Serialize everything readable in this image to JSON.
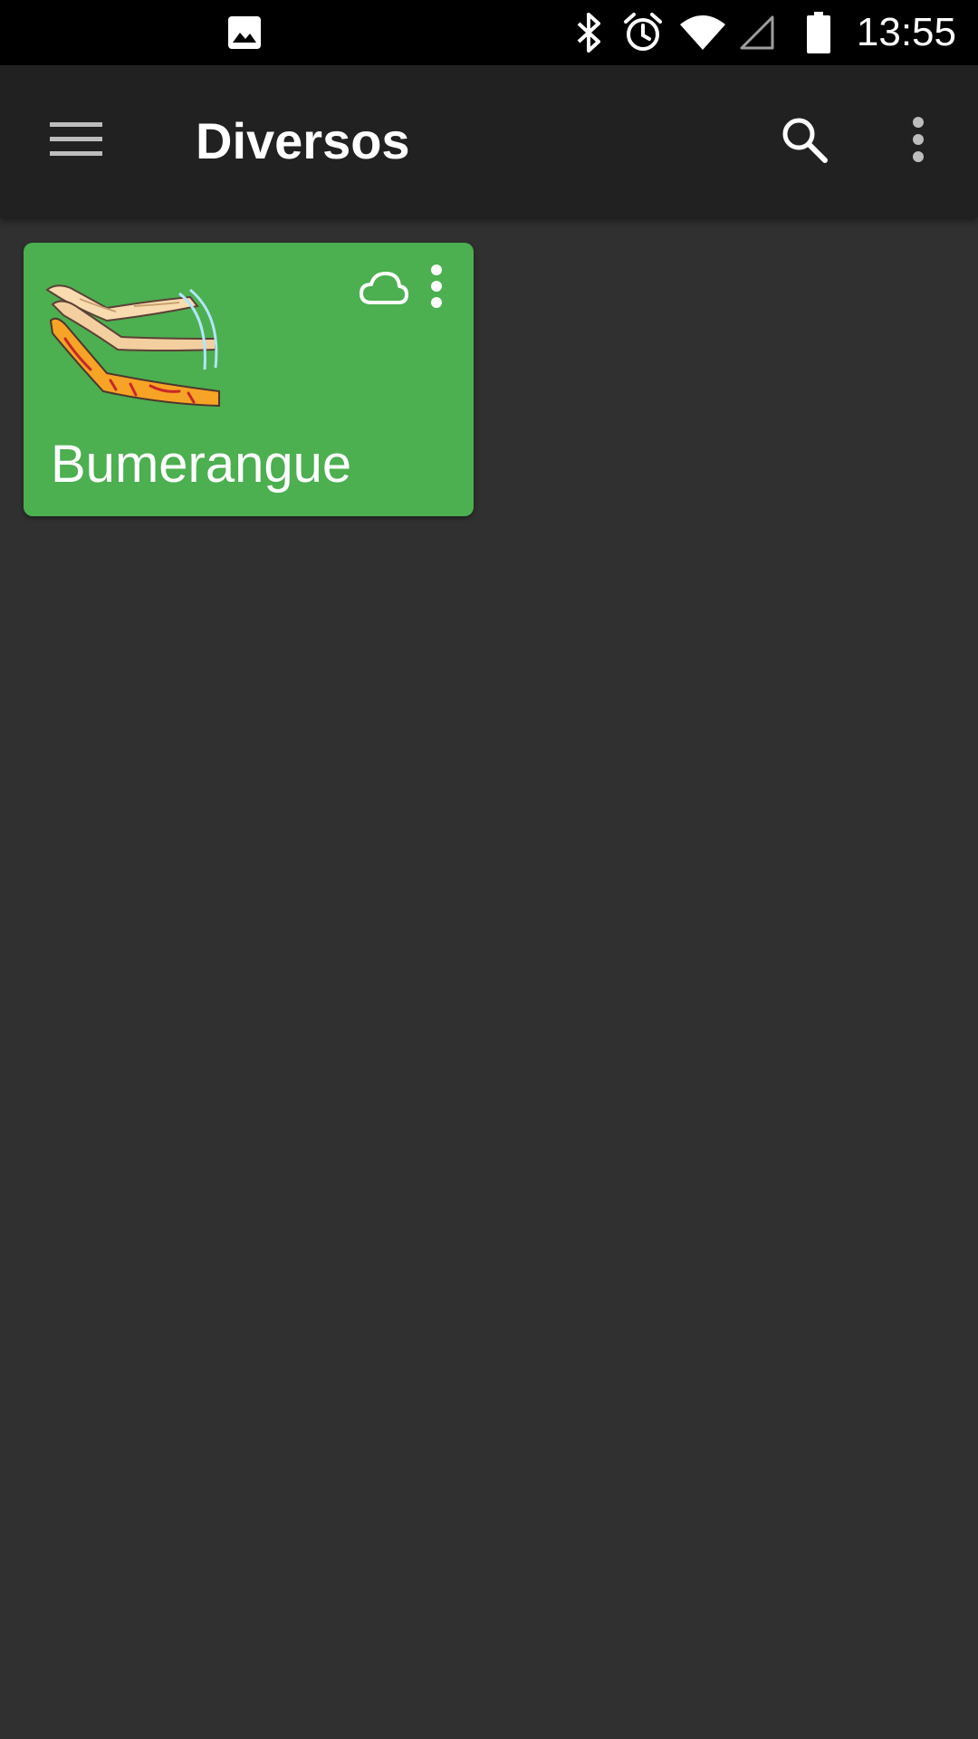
{
  "status_bar": {
    "time": "13:55",
    "icons": [
      "image-notification-icon",
      "bluetooth-icon",
      "alarm-icon",
      "wifi-icon",
      "cell-signal-icon",
      "battery-icon"
    ]
  },
  "app_bar": {
    "title": "Diversos",
    "nav_icon": "menu-icon",
    "actions": [
      "search-icon",
      "more-vert-icon"
    ],
    "background": "#212121"
  },
  "cards": [
    {
      "label": "Bumerangue",
      "color": "#4caf50",
      "image_icon": "boomerang-image",
      "status_icon": "cloud-icon",
      "menu_icon": "more-vert-icon"
    }
  ],
  "colors": {
    "page_background": "#303030",
    "status_bar": "#000000",
    "card_accent": "#4caf50"
  }
}
